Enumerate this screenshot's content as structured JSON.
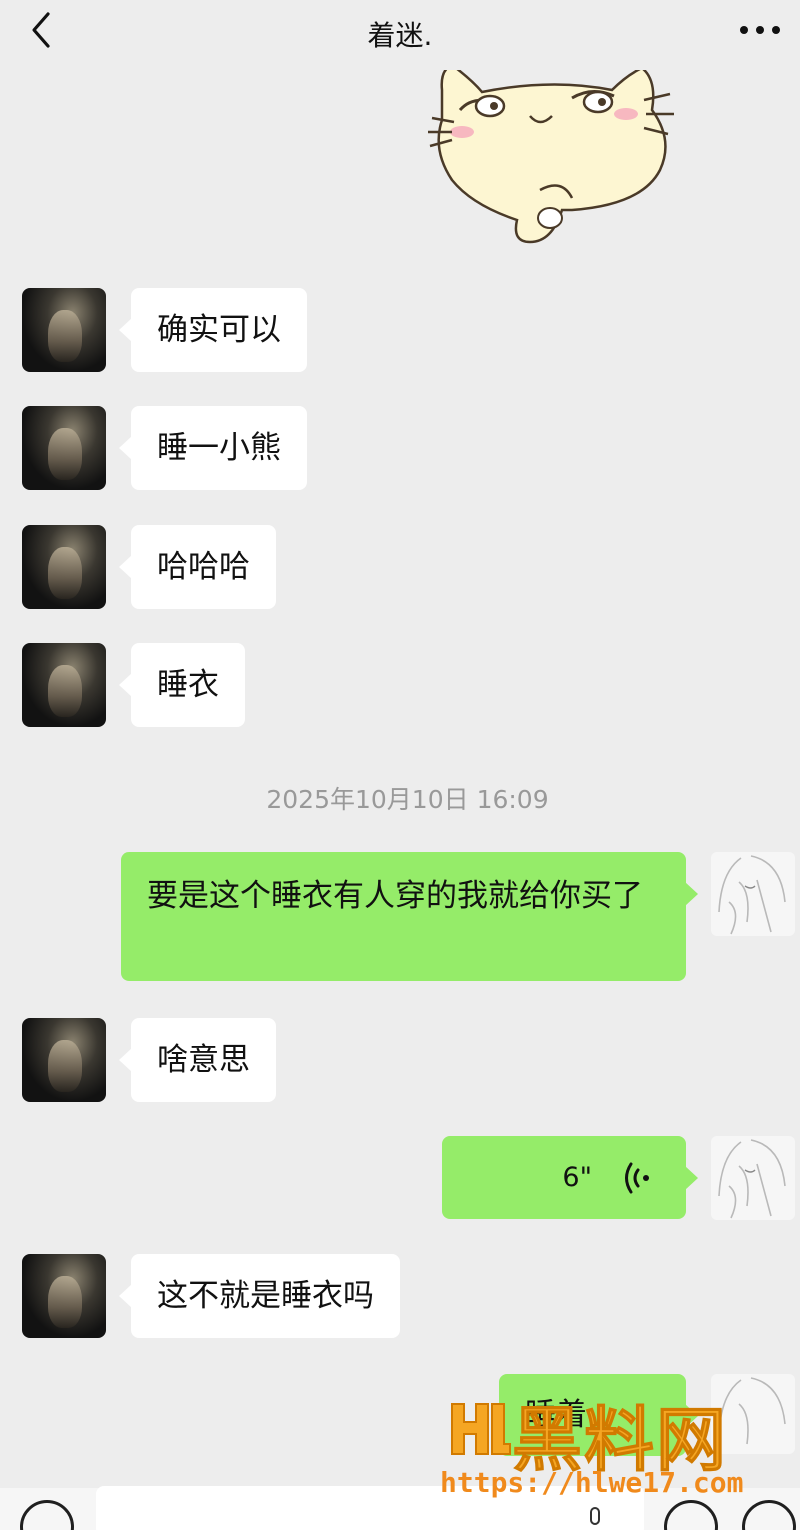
{
  "header": {
    "title": "着迷."
  },
  "messages": {
    "m1": "确实可以",
    "m2": "睡一小熊",
    "m3": "哈哈哈",
    "m4": "睡衣",
    "timestamp": "2025年10月10日 16:09",
    "m5": "要是这个睡衣有人穿的我就给你买了",
    "m6": "啥意思",
    "voice_duration": "6\"",
    "m7": "这不就是睡衣吗",
    "m8_partial": "睡着"
  },
  "watermark": {
    "title": "黑料网",
    "url": "https://hlwe17.com"
  },
  "colors": {
    "background": "#ededed",
    "sent_bubble": "#95ec69",
    "received_bubble": "#ffffff",
    "watermark": "#f5a623"
  }
}
